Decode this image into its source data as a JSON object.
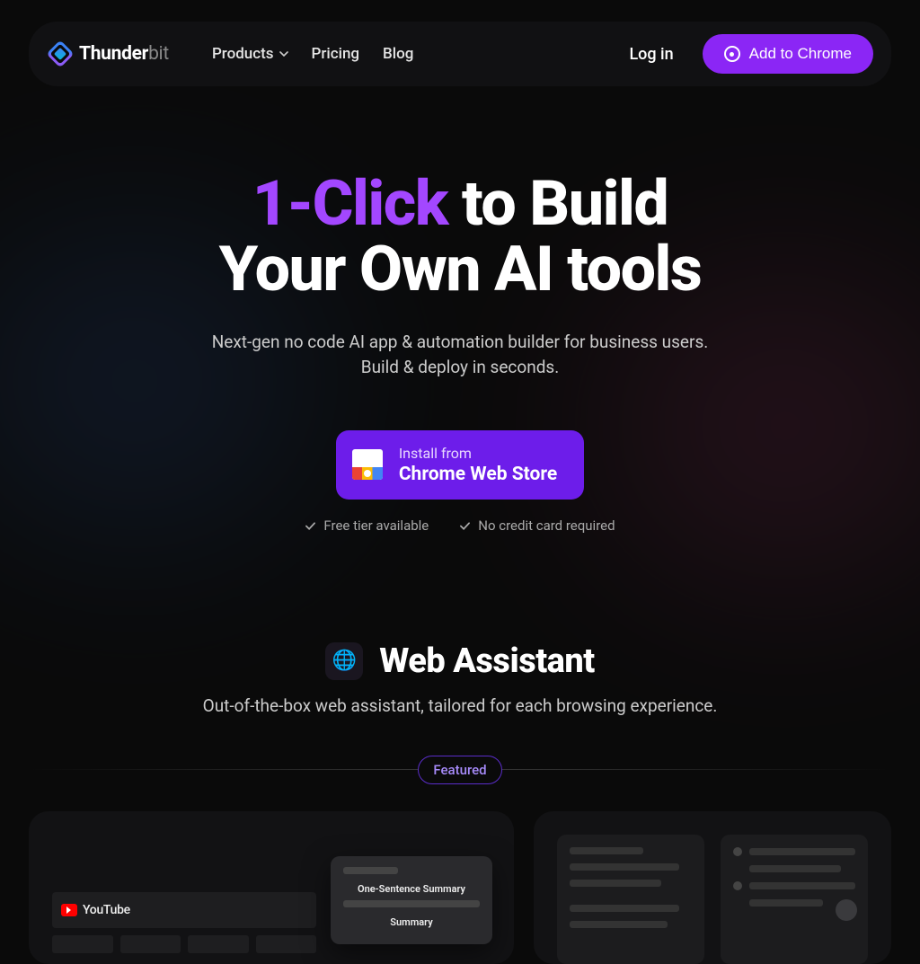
{
  "header": {
    "logo_bold": "Thunder",
    "logo_light": "bit",
    "nav": {
      "products": "Products",
      "pricing": "Pricing",
      "blog": "Blog"
    },
    "login": "Log in",
    "cta": "Add to Chrome"
  },
  "hero": {
    "title_accent": "1-Click",
    "title_rest1": " to Build",
    "title_line2": "Your Own AI tools",
    "sub1": "Next-gen no code AI app & automation builder for business users.",
    "sub2": "Build & deploy in seconds.",
    "install_small": "Install from",
    "install_big": "Chrome Web Store",
    "perk1": "Free tier available",
    "perk2": "No credit card required"
  },
  "section": {
    "globe": "🌐",
    "title": "Web Assistant",
    "sub": "Out-of-the-box web assistant, tailored for each browsing experience.",
    "featured": "Featured"
  },
  "card_left": {
    "youtube": "YouTube",
    "panel_h1": "One-Sentence Summary",
    "panel_h2": "Summary"
  }
}
